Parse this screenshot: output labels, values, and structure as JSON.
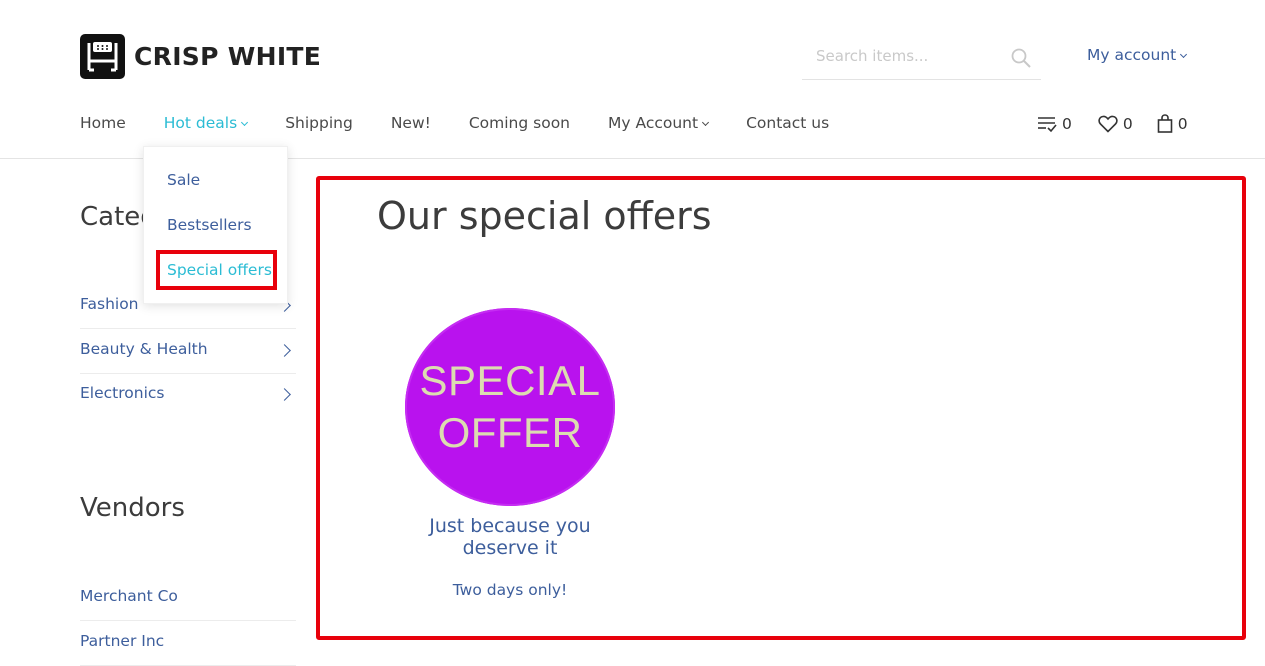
{
  "brand": {
    "name": "CRISP WHITE"
  },
  "search": {
    "placeholder": "Search items..."
  },
  "account": {
    "label": "My account"
  },
  "nav": {
    "items": [
      {
        "label": "Home"
      },
      {
        "label": "Hot deals"
      },
      {
        "label": "Shipping"
      },
      {
        "label": "New!"
      },
      {
        "label": "Coming soon"
      },
      {
        "label": "My Account"
      },
      {
        "label": "Contact us"
      }
    ]
  },
  "header_icons": {
    "compare_count": "0",
    "wishlist_count": "0",
    "cart_count": "0"
  },
  "dropdown": {
    "items": [
      {
        "label": "Sale"
      },
      {
        "label": "Bestsellers"
      },
      {
        "label": "Special offers"
      }
    ]
  },
  "sidebar": {
    "categories_title": "Categ",
    "categories": [
      {
        "label": "Fashion"
      },
      {
        "label": "Beauty & Health"
      },
      {
        "label": "Electronics"
      }
    ],
    "vendors_title": "Vendors",
    "vendors": [
      {
        "label": "Merchant Co"
      },
      {
        "label": "Partner Inc"
      }
    ]
  },
  "main": {
    "title": "Our special offers",
    "product": {
      "badge_line1": "SPECIAL",
      "badge_line2": "OFFER",
      "name": "Just because you deserve it",
      "subtitle": "Two days only!"
    }
  },
  "colors": {
    "accent": "#2bbcd4",
    "link": "#3d5e9c",
    "highlight": "#e8000b",
    "badge": "#b912ee",
    "badge_text": "#dcdcb0"
  }
}
